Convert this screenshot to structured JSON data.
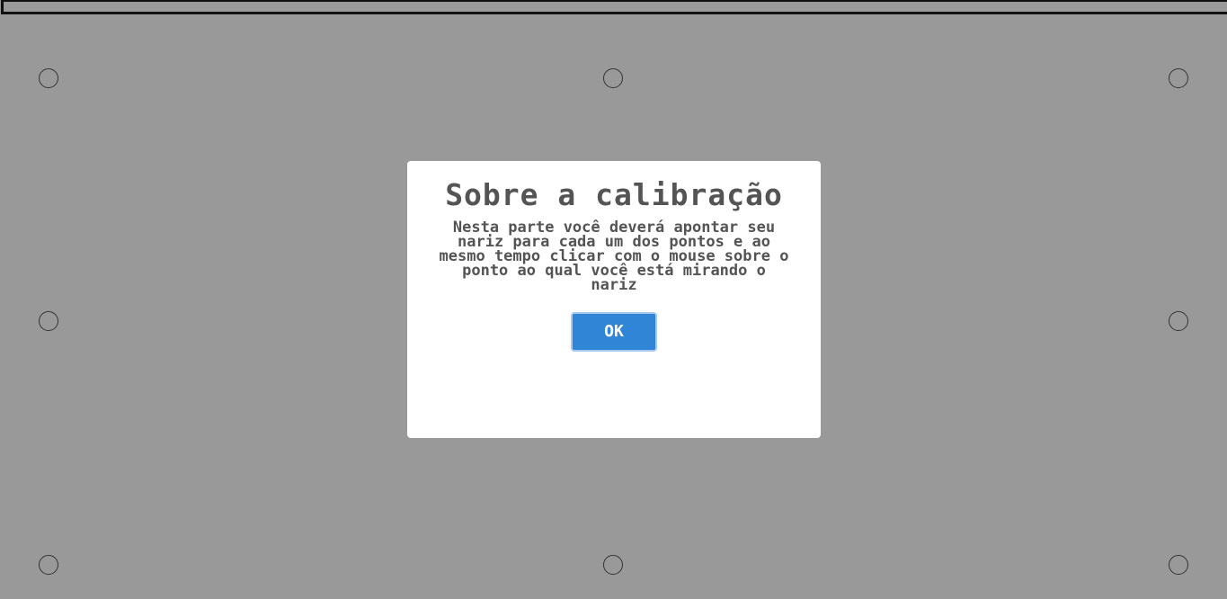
{
  "calibration_points": [
    "Pt1",
    "Pt2",
    "Pt3",
    "Pt4",
    "Pt5",
    "Pt6",
    "Pt7",
    "Pt8"
  ],
  "modal": {
    "title": "Sobre a calibração",
    "text": "Nesta parte você deverá apontar seu nariz para cada um dos pontos e ao mesmo tempo clicar com o mouse sobre o ponto ao qual você está mirando o nariz",
    "ok_label": "OK"
  },
  "colors": {
    "overlay": "#999999",
    "modal_background": "#ffffff",
    "text": "#545454",
    "button": "#3085d6"
  }
}
